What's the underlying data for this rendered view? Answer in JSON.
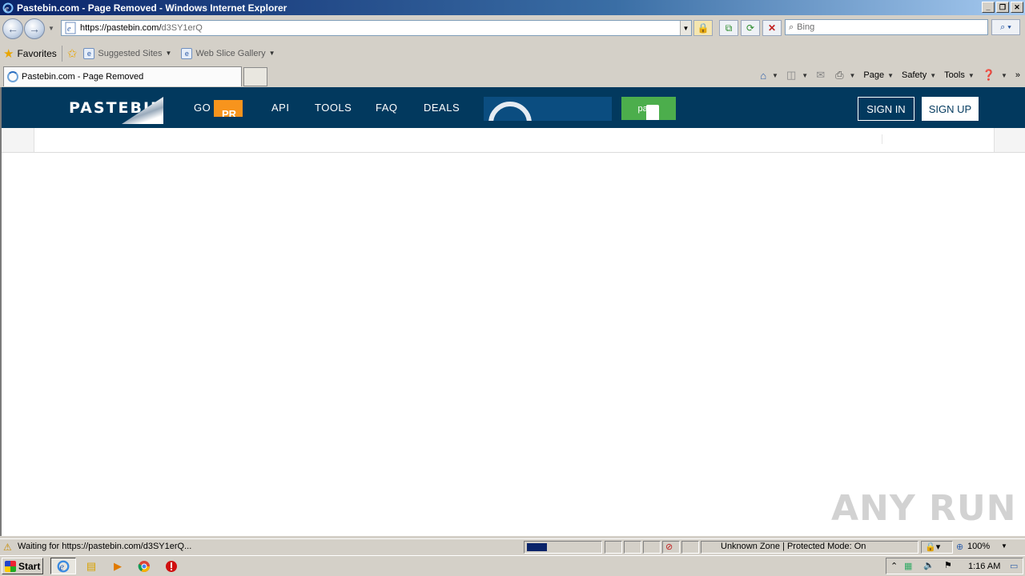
{
  "window": {
    "title": "Pastebin.com - Page Removed - Windows Internet Explorer"
  },
  "address_bar": {
    "url_host": "https://pastebin.com/",
    "url_path": "d3SY1erQ"
  },
  "search": {
    "placeholder": "Bing"
  },
  "favorites_bar": {
    "favorites_label": "Favorites",
    "items": [
      {
        "label": "Suggested Sites"
      },
      {
        "label": "Web Slice Gallery"
      }
    ]
  },
  "tab": {
    "label": "Pastebin.com - Page Removed"
  },
  "command_bar": {
    "page_label": "Page",
    "safety_label": "Safety",
    "tools_label": "Tools"
  },
  "pastebin": {
    "logo": "PASTEBIN",
    "nav": {
      "go": "GO",
      "api": "API",
      "tools": "TOOLS",
      "faq": "FAQ",
      "deals": "DEALS"
    },
    "paste_button": "paste",
    "sign_in": "SIGN IN",
    "sign_up": "SIGN UP"
  },
  "status_bar": {
    "text": "Waiting for https://pastebin.com/d3SY1erQ...",
    "zone": "Unknown Zone | Protected Mode: On",
    "zoom": "100%"
  },
  "taskbar": {
    "start_label": "Start",
    "clock": "1:16 AM"
  },
  "watermark": "ANY RUN"
}
